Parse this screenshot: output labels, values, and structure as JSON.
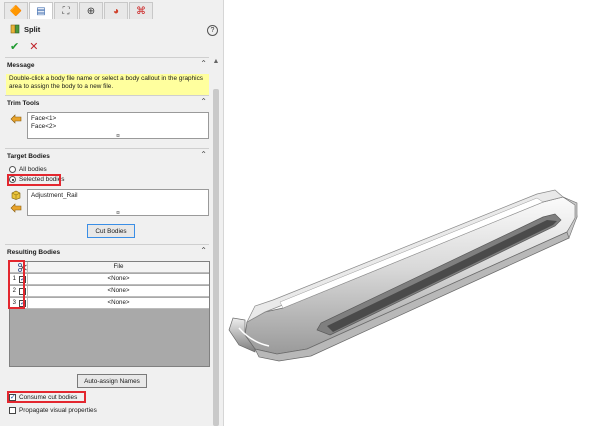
{
  "toolbar": {
    "tabs": [
      {
        "icon": "feature-manager-icon",
        "glyph": "🔶"
      },
      {
        "icon": "property-manager-icon",
        "glyph": "▤"
      },
      {
        "icon": "configuration-manager-icon",
        "glyph": "⛶"
      },
      {
        "icon": "dimxpert-icon",
        "glyph": "⊕"
      },
      {
        "icon": "display-manager-icon",
        "glyph": "◕"
      },
      {
        "icon": "cam-icon",
        "glyph": "⌘"
      }
    ],
    "help_glyph": "?"
  },
  "feature": {
    "title": "Split",
    "icon": "split-feature-icon"
  },
  "actions": {
    "ok_glyph": "✔",
    "cancel_glyph": "✕"
  },
  "message": {
    "header": "Message",
    "text": "Double-click a body file name or select a body callout in the graphics area to assign the body to a new file."
  },
  "trim_tools": {
    "header": "Trim Tools",
    "items": [
      "Face<1>",
      "Face<2>"
    ]
  },
  "target_bodies": {
    "header": "Target Bodies",
    "options": [
      "All bodies",
      "Selected bodies"
    ],
    "selected_option": "Selected bodies",
    "items": [
      "Adjustment_Rail"
    ],
    "cut_button": "Cut Bodies"
  },
  "resulting_bodies": {
    "header": "Resulting Bodies",
    "column_file": "File",
    "rows": [
      {
        "num": "1",
        "checked": true,
        "file": "<None>"
      },
      {
        "num": "2",
        "checked": false,
        "file": "<None>"
      },
      {
        "num": "3",
        "checked": true,
        "file": "<None>"
      }
    ],
    "auto_assign_button": "Auto-assign Names"
  },
  "options": {
    "consume_cut_bodies": {
      "label": "Consume cut bodies",
      "checked": true
    },
    "propagate_visual": {
      "label": "Propagate visual properties",
      "checked": false
    }
  },
  "colors": {
    "highlight": "#e3272f",
    "message_bg": "#ffff9e",
    "accent": "#3a8ee6"
  }
}
